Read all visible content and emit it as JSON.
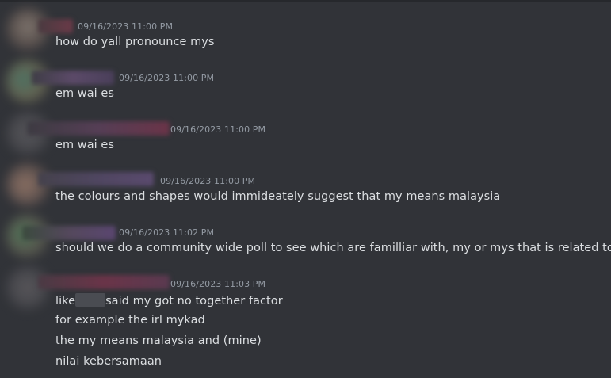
{
  "messages": [
    {
      "timestamp": "09/16/2023 11:00 PM",
      "lines": [
        "how do yall pronounce mys"
      ]
    },
    {
      "timestamp": "09/16/2023 11:00 PM",
      "lines": [
        "em wai es"
      ]
    },
    {
      "timestamp": "09/16/2023 11:00 PM",
      "lines": [
        "em wai es"
      ]
    },
    {
      "timestamp": "09/16/2023 11:00 PM",
      "lines": [
        "the colours and shapes would immideately suggest that my means malaysia"
      ]
    },
    {
      "timestamp": "09/16/2023 11:02 PM",
      "lines": [
        "should we do a community wide poll to see which are familliar with, my or mys that is related to us"
      ]
    },
    {
      "timestamp": "09/16/2023 11:03 PM",
      "lines": [
        {
          "before": "like",
          "after": "said my got no together factor"
        },
        "for example the irl mykad",
        "the my means malaysia and (mine)",
        "nilai kebersamaan"
      ]
    }
  ],
  "colors": {
    "background": "#313338",
    "text": "#dbdee1",
    "timestamp": "#949ba4"
  }
}
